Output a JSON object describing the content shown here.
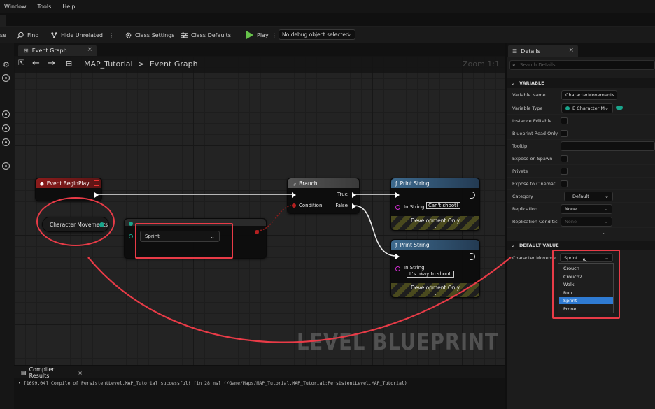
{
  "menu": {
    "items": [
      "Window",
      "Tools",
      "Help"
    ]
  },
  "toolbar": {
    "cut_label": "se",
    "find_label": "Find",
    "hide_unrelated_label": "Hide Unrelated",
    "class_settings_label": "Class Settings",
    "class_defaults_label": "Class Defaults",
    "play_label": "Play",
    "debug_object": "No debug object selected",
    "play_color": "#66c24a"
  },
  "graph": {
    "tab_label": "Event Graph",
    "breadcrumb_root": "MAP_Tutorial",
    "breadcrumb_sep": ">",
    "breadcrumb_leaf": "Event Graph",
    "zoom_label": "Zoom 1:1",
    "watermark": "LEVEL BLUEPRINT"
  },
  "nodes": {
    "begin_play": {
      "title": "Event BeginPlay",
      "color": "#8c1b1b"
    },
    "character_movements": {
      "label": "Character Movements"
    },
    "compare": {
      "selected": "Sprint"
    },
    "branch": {
      "title": "Branch",
      "true_label": "True",
      "false_label": "False",
      "condition_label": "Condition"
    },
    "print1": {
      "title": "Print String",
      "in_string_label": "In String",
      "in_string_value": "Can't shoot!",
      "dev_only": "Development Only"
    },
    "print2": {
      "title": "Print String",
      "in_string_label": "In String",
      "in_string_value": "It's okay to shoot.",
      "dev_only": "Development Only"
    }
  },
  "compiler": {
    "tab_label": "Compiler Results",
    "message": "• [1699.04] Compile of PersistentLevel.MAP_Tutorial successful! [in 28 ms] (/Game/Maps/MAP_Tutorial.MAP_Tutorial:PersistentLevel.MAP_Tutorial)"
  },
  "details": {
    "tab_label": "Details",
    "search_placeholder": "Search Details",
    "variable_section": "VARIABLE",
    "default_section": "DEFAULT VALUE",
    "rows": {
      "variable_name": {
        "label": "Variable Name",
        "value": "CharacterMovements"
      },
      "variable_type": {
        "label": "Variable Type",
        "value": "E Character M"
      },
      "instance_editable": {
        "label": "Instance Editable"
      },
      "blueprint_read_only": {
        "label": "Blueprint Read Only"
      },
      "tooltip": {
        "label": "Tooltip"
      },
      "expose_on_spawn": {
        "label": "Expose on Spawn"
      },
      "private": {
        "label": "Private"
      },
      "expose_cinematics": {
        "label": "Expose to Cinemati"
      },
      "category": {
        "label": "Category",
        "value": "Default"
      },
      "replication": {
        "label": "Replication",
        "value": "None"
      },
      "replication_condition": {
        "label": "Replication Conditic",
        "value": "None"
      },
      "character_movements_default": {
        "label": "Character Moveme",
        "value": "Sprint"
      }
    },
    "dropdown_options": [
      "Crouch",
      "Crouch2",
      "Walk",
      "Run",
      "Sprint",
      "Prone"
    ],
    "dropdown_selected": "Sprint",
    "highlight_color": "#2f7bd3"
  },
  "annotation_color": "#e83b47"
}
